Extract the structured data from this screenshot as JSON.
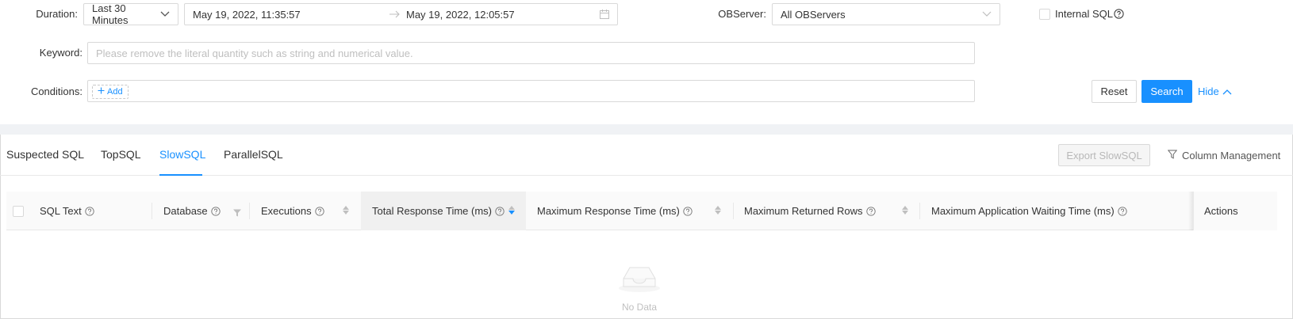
{
  "filters": {
    "duration_label": "Duration",
    "duration_value": "Last 30 Minutes",
    "range_start": "May 19, 2022, 11:35:57",
    "range_end": "May 19, 2022, 12:05:57",
    "observer_label": "OBServer",
    "observer_value": "All OBServers",
    "internal_sql_label": "Internal SQL",
    "keyword_label": "Keyword",
    "keyword_placeholder": "Please remove the literal quantity such as string and numerical value.",
    "keyword_value": "",
    "conditions_label": "Conditions",
    "add_label": "Add",
    "reset_label": "Reset",
    "search_label": "Search",
    "hide_label": "Hide"
  },
  "tabs": [
    {
      "label": "Suspected SQL",
      "active": false
    },
    {
      "label": "TopSQL",
      "active": false
    },
    {
      "label": "SlowSQL",
      "active": true
    },
    {
      "label": "ParallelSQL",
      "active": false
    }
  ],
  "toolbar": {
    "export_label": "Export SlowSQL",
    "column_mgmt_label": "Column Management"
  },
  "table": {
    "columns": [
      "SQL Text",
      "Database",
      "Executions",
      "Total Response Time (ms)",
      "Maximum Response Time (ms)",
      "Maximum Returned Rows",
      "Maximum Application Waiting Time (ms)",
      "Actions"
    ],
    "rows": [],
    "empty_text": "No Data"
  },
  "colors": {
    "accent": "#1890ff",
    "border": "#d9d9d9",
    "band": "#f0f2f5"
  }
}
